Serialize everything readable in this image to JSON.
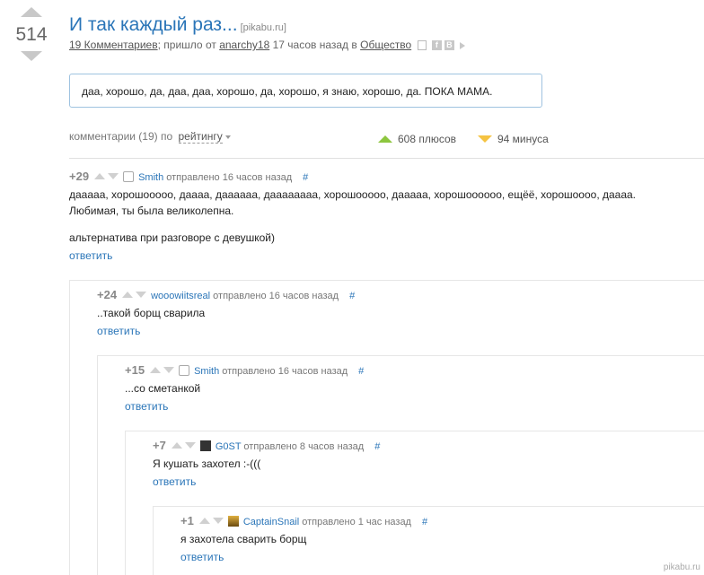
{
  "story": {
    "rating": "514",
    "title": "И так каждый раз...",
    "source": "[pikabu.ru]",
    "comments_link": "19 Комментариев",
    "meta_sep": ";",
    "came_from": "пришло от",
    "author": "anarchy18",
    "time": "17 часов назад в",
    "community": "Общество",
    "text": "даа, хорошо, да, даа, даа, хорошо, да, хорошо, я знаю, хорошо, да. ПОКА МАМА."
  },
  "sort": {
    "label": "комментарии (19) по",
    "value": "рейтингу"
  },
  "stats": {
    "plus": "608 плюсов",
    "minus": "94 минуса"
  },
  "comments": [
    {
      "score": "+29",
      "user": "Smith",
      "sent": "отправлено 16 часов назад",
      "hash": "#",
      "text1": "дааааа, хорошооооо, даааа, даааааа, даааааааа, хорошооооо, дааааа, хорошоооооо, ещёё, хорошоооо, даааа. Любимая, ты была великолепна.",
      "text2": "альтернатива при разговоре с девушкой)",
      "reply": "ответить"
    },
    {
      "score": "+24",
      "user": "wooowiitsreal",
      "sent": "отправлено 16 часов назад",
      "hash": "#",
      "text1": "..такой борщ сварила",
      "reply": "ответить"
    },
    {
      "score": "+15",
      "user": "Smith",
      "sent": "отправлено 16 часов назад",
      "hash": "#",
      "text1": "...со сметанкой",
      "reply": "ответить"
    },
    {
      "score": "+7",
      "user": "G0ST",
      "sent": "отправлено 8 часов назад",
      "hash": "#",
      "text1": "Я кушать захотел :-(((",
      "reply": "ответить"
    },
    {
      "score": "+1",
      "user": "CaptainSnail",
      "sent": "отправлено 1 час назад",
      "hash": "#",
      "text1": "я захотела сварить борщ",
      "reply": "ответить"
    }
  ],
  "watermark": "pikabu.ru"
}
